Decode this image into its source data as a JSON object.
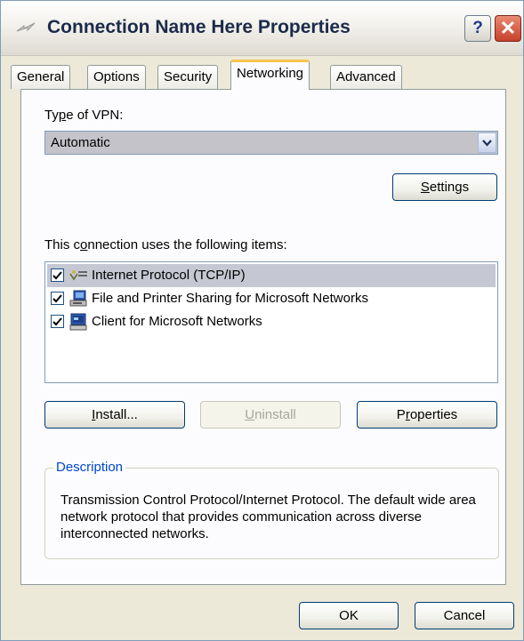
{
  "window": {
    "title": "Connection Name Here Properties",
    "help_label": "?",
    "close_label": "✕"
  },
  "tabs": [
    {
      "label": "General",
      "active": false
    },
    {
      "label": "Options",
      "active": false
    },
    {
      "label": "Security",
      "active": false
    },
    {
      "label": "Networking",
      "active": true
    },
    {
      "label": "Advanced",
      "active": false
    }
  ],
  "networking": {
    "vpn_type_label_pre": "Ty",
    "vpn_type_label_key": "p",
    "vpn_type_label_post": "e of VPN:",
    "vpn_type_value": "Automatic",
    "settings_key": "S",
    "settings_rest": "ettings",
    "items_label_pre": "This c",
    "items_label_key": "o",
    "items_label_post": "nnection uses the following items:",
    "items": [
      {
        "label": "Internet Protocol (TCP/IP)",
        "checked": true,
        "icon": "network-protocol-icon",
        "selected": true
      },
      {
        "label": "File and Printer Sharing for Microsoft Networks",
        "checked": true,
        "icon": "network-service-icon",
        "selected": false
      },
      {
        "label": "Client for Microsoft Networks",
        "checked": true,
        "icon": "network-client-icon",
        "selected": false
      }
    ],
    "install_key": "I",
    "install_rest": "nstall...",
    "uninstall_key": "U",
    "uninstall_rest": "ninstall",
    "properties_pre": "P",
    "properties_key": "r",
    "properties_post": "operties",
    "description_title": "Description",
    "description_text": "Transmission Control Protocol/Internet Protocol. The default wide area network protocol that provides communication across diverse interconnected networks."
  },
  "footer": {
    "ok_label": "OK",
    "cancel_label": "Cancel"
  },
  "colors": {
    "dialog_bg": "#ece9d8",
    "panel_bg": "#fcfcfe",
    "active_tab_accent": "#f7c54b",
    "group_title": "#0046d5",
    "close_button": "#c7412b"
  }
}
